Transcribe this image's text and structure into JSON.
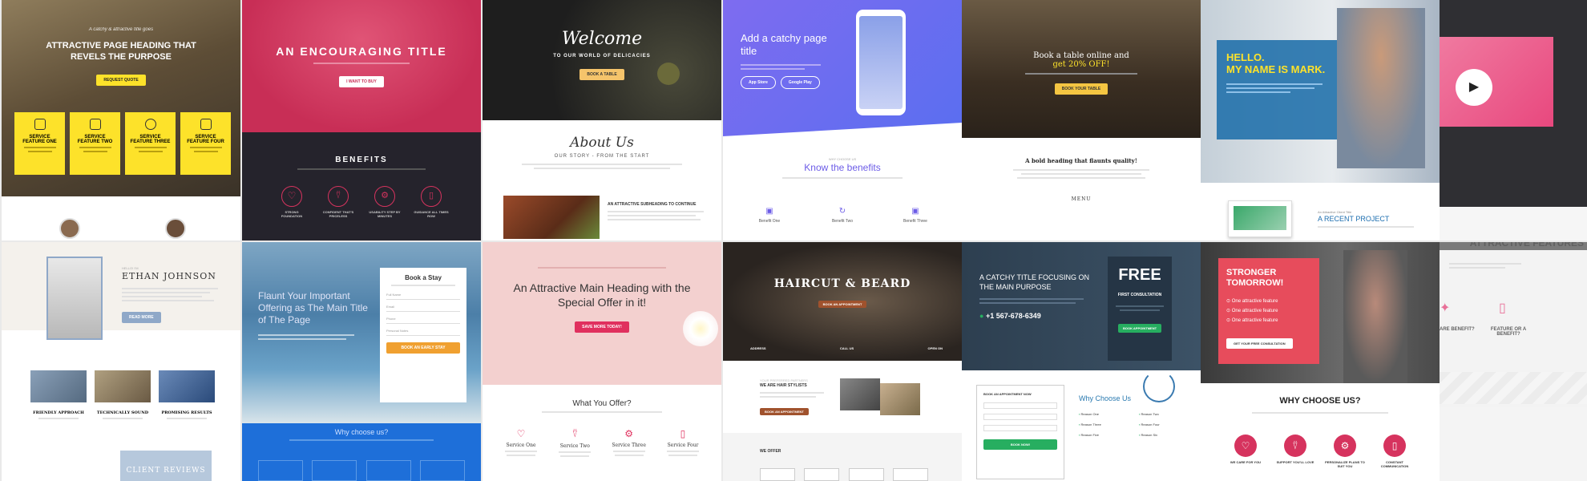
{
  "colors": {
    "yellow": "#fde22a",
    "crimson": "#d6335e",
    "purple": "#6c5ce7",
    "navy": "#2c3e50",
    "green": "#27ae60",
    "blue": "#1e6fd9",
    "pink": "#e8487e",
    "salmon": "#f2cccc",
    "red": "#e74c5c"
  },
  "t1": {
    "overline": "A catchy & attractive title goes",
    "heading": "ATTRACTIVE PAGE HEADING THAT REVELS THE PURPOSE",
    "button": "REQUEST QUOTE",
    "features": [
      {
        "title": "SERVICE FEATURE ONE"
      },
      {
        "title": "SERVICE FEATURE TWO"
      },
      {
        "title": "SERVICE FEATURE THREE"
      },
      {
        "title": "SERVICE FEATURE FOUR"
      }
    ]
  },
  "t2": {
    "heading": "AN ENCOURAGING TITLE",
    "button": "I WANT TO BUY",
    "benefits_title": "BENEFITS",
    "benefits": [
      {
        "label": "STRONG FOUNDATION"
      },
      {
        "label": "CONFIDENT THAT'S PRICELESS"
      },
      {
        "label": "USABILITY STEP BY MINUTES"
      },
      {
        "label": "GUIDANCE ALL TIMES ROW"
      }
    ]
  },
  "t3": {
    "script": "Welcome",
    "subtitle": "TO OUR WORLD OF DELICACIES",
    "button": "BOOK A TABLE",
    "about": "About Us",
    "story": "OUR STORY - FROM THE START",
    "subheading": "AN ATTRACTIVE SUBHEADING TO CONTINUE"
  },
  "t4": {
    "heading": "Add a catchy page title",
    "btn1": "App Store",
    "btn2": "Google Play",
    "benefits_title": "Know the benefits",
    "benefits": [
      {
        "label": "Benefit One"
      },
      {
        "label": "Benefit Two"
      },
      {
        "label": "Benefit Three"
      }
    ]
  },
  "t5": {
    "heading": "Book a table online and",
    "offer": "get 20% OFF!",
    "button": "BOOK YOUR TABLE",
    "bold_heading": "A bold heading that flaunts quality!",
    "menu": "MENU"
  },
  "t6": {
    "hello": "HELLO.",
    "name": "MY NAME IS MARK.",
    "project_label": "A RECENT PROJECT"
  },
  "t8": {
    "name": "ETHAN JOHNSON",
    "button": "READ MORE",
    "features": [
      {
        "title": "FRIENDLY APPROACH"
      },
      {
        "title": "TECHNICALLY SOUND"
      },
      {
        "title": "PROMISING RESULTS"
      }
    ],
    "reviews": "CLIENT REVIEWS"
  },
  "t9": {
    "heading": "Flaunt Your Important Offering as The Main Title of The Page",
    "form_title": "Book a Stay",
    "fields": [
      "Full Name",
      "Email",
      "Phone",
      "Personal Notes"
    ],
    "button": "BOOK AN EARLY STAY",
    "why": "Why choose us?"
  },
  "t10": {
    "heading": "An Attractive Main Heading with the Special Offer in it!",
    "button": "SAVE MORE TODAY!",
    "offer_title": "What You Offer?",
    "services": [
      {
        "label": "Service One"
      },
      {
        "label": "Service Two"
      },
      {
        "label": "Service Three"
      },
      {
        "label": "Service Four"
      }
    ]
  },
  "t11": {
    "heading": "HAIRCUT & BEARD",
    "badge": "BOOK AN APPOINTMENT",
    "info": [
      {
        "label": "ADDRESS"
      },
      {
        "label": "CALL US"
      },
      {
        "label": "OPEN ON"
      }
    ],
    "stylists": "WE ARE HAIR STYLISTS",
    "button": "BOOK AN APPOINTMENT",
    "offer": "WE OFFER"
  },
  "t12": {
    "heading": "A CATCHY TITLE FOCUSING ON THE MAIN PURPOSE",
    "phone": "+1 567-678-6349",
    "free": "FREE",
    "consult": "FIRST CONSULTATION",
    "button": "BOOK APPOINTMENT",
    "form_title": "BOOK AN APPOINTMENT NOW",
    "form_button": "BOOK NOW!",
    "why": "Why Choose Us",
    "reasons": [
      "Reason One",
      "Reason Two",
      "Reason Three",
      "Reason Four",
      "Reason Five",
      "Reason Six"
    ]
  },
  "t13": {
    "heading": "STRONGER TOMORROW!",
    "features": [
      "One attractive feature",
      "One attractive feature",
      "One attractive feature"
    ],
    "button": "GET YOUR FREE CONSULTATION",
    "why": "WHY CHOOSE US?",
    "items": [
      {
        "label": "WE CARE FOR YOU"
      },
      {
        "label": "SUPPORT YOU'LL LOVE"
      },
      {
        "label": "PERSONALIZE PLANS TO SUIT YOU"
      },
      {
        "label": "CONSTANT COMMUNICATION"
      }
    ]
  },
  "t14": {
    "heading": "ATTRACTIVE FEATURES",
    "f1": "ARE BENEFIT?",
    "f2": "FEATURE OR A BENEFIT?"
  }
}
